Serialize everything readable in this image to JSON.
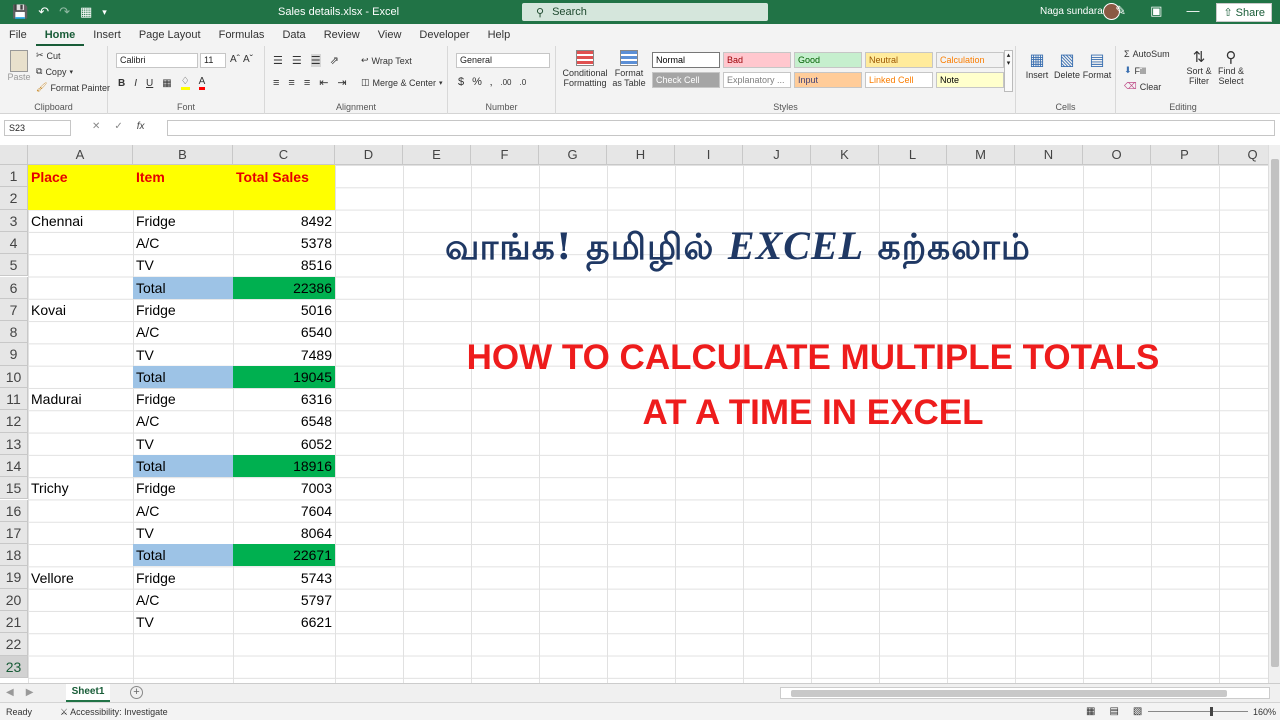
{
  "window": {
    "title": "Sales details.xlsx  -  Excel",
    "search_placeholder": "Search",
    "user_name": "Naga sundaram"
  },
  "ribbon_tabs": [
    {
      "label": "File"
    },
    {
      "label": "Home"
    },
    {
      "label": "Insert"
    },
    {
      "label": "Page Layout"
    },
    {
      "label": "Formulas"
    },
    {
      "label": "Data"
    },
    {
      "label": "Review"
    },
    {
      "label": "View"
    },
    {
      "label": "Developer"
    },
    {
      "label": "Help"
    }
  ],
  "share_label": "Share",
  "clipboard": {
    "paste": "Paste",
    "cut": "Cut",
    "copy": "Copy",
    "format_painter": "Format Painter",
    "label": "Clipboard"
  },
  "font": {
    "name": "Calibri",
    "size": "11",
    "label": "Font"
  },
  "alignment": {
    "wrap_text": "Wrap Text",
    "merge_center": "Merge & Center",
    "label": "Alignment"
  },
  "number": {
    "format": "General",
    "label": "Number"
  },
  "styles": {
    "conditional": "Conditional Formatting",
    "format_table": "Format as Table",
    "label": "Styles",
    "cells": [
      {
        "label": "Normal",
        "bg": "#ffffff",
        "fg": "#000000"
      },
      {
        "label": "Bad",
        "bg": "#ffc7ce",
        "fg": "#9c0006"
      },
      {
        "label": "Good",
        "bg": "#c6efce",
        "fg": "#006100"
      },
      {
        "label": "Neutral",
        "bg": "#ffeb9c",
        "fg": "#9c5700"
      },
      {
        "label": "Calculation",
        "bg": "#f2f2f2",
        "fg": "#fa7d00"
      },
      {
        "label": "Check Cell",
        "bg": "#a5a5a5",
        "fg": "#ffffff"
      },
      {
        "label": "Explanatory ...",
        "bg": "#ffffff",
        "fg": "#7f7f7f"
      },
      {
        "label": "Input",
        "bg": "#ffcc99",
        "fg": "#3f3f76"
      },
      {
        "label": "Linked Cell",
        "bg": "#ffffff",
        "fg": "#fa7d00"
      },
      {
        "label": "Note",
        "bg": "#ffffcc",
        "fg": "#000000"
      }
    ]
  },
  "cells_group": {
    "insert": "Insert",
    "delete": "Delete",
    "format": "Format",
    "label": "Cells"
  },
  "editing": {
    "autosum": "AutoSum",
    "fill": "Fill",
    "clear": "Clear",
    "sort_filter": "Sort & Filter",
    "find_select": "Find & Select",
    "label": "Editing"
  },
  "formula_bar": {
    "name_box": "S23",
    "formula": ""
  },
  "columns": [
    "A",
    "B",
    "C",
    "D",
    "E",
    "F",
    "G",
    "H",
    "I",
    "J",
    "K",
    "L",
    "M",
    "N",
    "O",
    "P",
    "Q"
  ],
  "rows": [
    "1",
    "2",
    "3",
    "4",
    "5",
    "6",
    "7",
    "8",
    "9",
    "10",
    "11",
    "12",
    "13",
    "14",
    "15",
    "16",
    "17",
    "18",
    "19",
    "20",
    "21",
    "22",
    "23"
  ],
  "sheet": {
    "header": {
      "place": "Place",
      "item": "Item",
      "total_sales": "Total Sales"
    },
    "rows": [
      {
        "row": 3,
        "place": "Chennai",
        "item": "Fridge",
        "sales": "8492"
      },
      {
        "row": 4,
        "place": "",
        "item": "A/C",
        "sales": "5378"
      },
      {
        "row": 5,
        "place": "",
        "item": "TV",
        "sales": "8516"
      },
      {
        "row": 6,
        "place": "",
        "item": "Total",
        "sales": "22386",
        "total": true
      },
      {
        "row": 7,
        "place": "Kovai",
        "item": "Fridge",
        "sales": "5016"
      },
      {
        "row": 8,
        "place": "",
        "item": "A/C",
        "sales": "6540"
      },
      {
        "row": 9,
        "place": "",
        "item": "TV",
        "sales": "7489"
      },
      {
        "row": 10,
        "place": "",
        "item": "Total",
        "sales": "19045",
        "total": true
      },
      {
        "row": 11,
        "place": "Madurai",
        "item": "Fridge",
        "sales": "6316"
      },
      {
        "row": 12,
        "place": "",
        "item": "A/C",
        "sales": "6548"
      },
      {
        "row": 13,
        "place": "",
        "item": "TV",
        "sales": "6052"
      },
      {
        "row": 14,
        "place": "",
        "item": "Total",
        "sales": "18916",
        "total": true
      },
      {
        "row": 15,
        "place": "Trichy",
        "item": "Fridge",
        "sales": "7003"
      },
      {
        "row": 16,
        "place": "",
        "item": "A/C",
        "sales": "7604"
      },
      {
        "row": 17,
        "place": "",
        "item": "TV",
        "sales": "8064"
      },
      {
        "row": 18,
        "place": "",
        "item": "Total",
        "sales": "22671",
        "total": true
      },
      {
        "row": 19,
        "place": "Vellore",
        "item": "Fridge",
        "sales": "5743"
      },
      {
        "row": 20,
        "place": "",
        "item": "A/C",
        "sales": "5797"
      },
      {
        "row": 21,
        "place": "",
        "item": "TV",
        "sales": "6621"
      }
    ]
  },
  "overlay": {
    "tamil_part1": "வாங்க! தமிழில் ",
    "tamil_excel": "EXCEL",
    "tamil_part2": " கற்கலாம்",
    "english_line1": "HOW TO CALCULATE MULTIPLE TOTALS",
    "english_line2": "AT A TIME IN EXCEL"
  },
  "sheet_tab": "Sheet1",
  "status": {
    "ready": "Ready",
    "accessibility": "Accessibility: Investigate",
    "zoom": "160%"
  },
  "colors": {
    "excel_green": "#217346",
    "header_yellow": "#ffff00",
    "total_blue": "#9dc3e6",
    "total_green": "#00b050",
    "header_red": "#e60000",
    "overlay_red": "#ee1c1c",
    "overlay_navy": "#1f3864"
  }
}
